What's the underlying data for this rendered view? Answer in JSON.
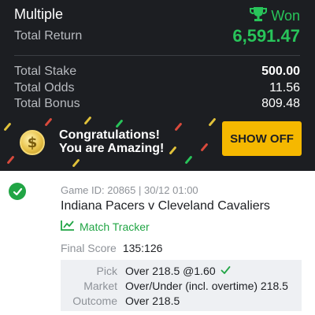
{
  "header": {
    "bet_type": "Multiple",
    "status": "Won",
    "status_icon": "trophy-icon",
    "total_return_label": "Total Return",
    "total_return_value": "6,591.47"
  },
  "stats": [
    {
      "label": "Total Stake",
      "value": "500.00"
    },
    {
      "label": "Total Odds",
      "value": "11.56"
    },
    {
      "label": "Total Bonus",
      "value": "809.48"
    }
  ],
  "promo": {
    "coin_icon": "dollar-coin-icon",
    "line1": "Congratulations!",
    "line2": "You are Amazing!",
    "button_label": "SHOW OFF"
  },
  "selection": {
    "status_icon": "checkmark-circle-icon",
    "game_info": "Game ID: 20865 | 30/12 01:00",
    "matchup": "Indiana Pacers v Cleveland Cavaliers",
    "tracker_icon": "line-chart-icon",
    "tracker_label": "Match Tracker",
    "final_score_label": "Final Score",
    "final_score_value": "135:126",
    "pick_label": "Pick",
    "pick_value": "Over 218.5 @1.60",
    "market_label": "Market",
    "market_value": "Over/Under (incl. overtime) 218.5",
    "outcome_label": "Outcome",
    "outcome_value": "Over 218.5"
  },
  "colors": {
    "background_dark": "#1c1e22",
    "accent_green": "#28c45a",
    "button_yellow": "#f5b800",
    "panel_grey": "#eef0f3"
  }
}
